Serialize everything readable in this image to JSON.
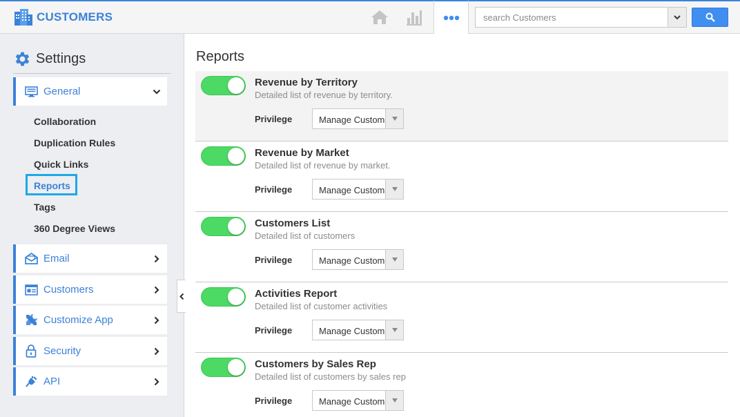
{
  "app": {
    "title": "CUSTOMERS",
    "brand_color": "#3b82d8"
  },
  "topbar": {
    "icons": [
      "home-icon",
      "bar-chart-icon",
      "more-icon"
    ],
    "search_placeholder": "search Customers",
    "search_button_icon": "search-icon"
  },
  "sidebar": {
    "title": "Settings",
    "general": {
      "label": "General",
      "expanded": true
    },
    "sub_items": [
      {
        "label": "Collaboration",
        "active": false
      },
      {
        "label": "Duplication Rules",
        "active": false
      },
      {
        "label": "Quick Links",
        "active": false
      },
      {
        "label": "Reports",
        "active": true
      },
      {
        "label": "Tags",
        "active": false
      },
      {
        "label": "360 Degree Views",
        "active": false
      }
    ],
    "items": [
      {
        "label": "Email",
        "icon": "email-icon"
      },
      {
        "label": "Customers",
        "icon": "customers-icon"
      },
      {
        "label": "Customize App",
        "icon": "tools-icon"
      },
      {
        "label": "Security",
        "icon": "lock-icon"
      },
      {
        "label": "API",
        "icon": "plug-icon"
      }
    ]
  },
  "main": {
    "title": "Reports",
    "privilege_label": "Privilege",
    "reports": [
      {
        "title": "Revenue by Territory",
        "desc": "Detailed list of revenue by territory.",
        "enabled": true,
        "privilege": "Manage Customers"
      },
      {
        "title": "Revenue by Market",
        "desc": "Detailed list of revenue by market.",
        "enabled": true,
        "privilege": "Manage Customers"
      },
      {
        "title": "Customers List",
        "desc": "Detailed list of customers",
        "enabled": true,
        "privilege": "Manage Customers"
      },
      {
        "title": "Activities Report",
        "desc": "Detailed list of customer activities",
        "enabled": true,
        "privilege": "Manage Customers"
      },
      {
        "title": "Customers by Sales Rep",
        "desc": "Detailed list of customers by sales rep",
        "enabled": true,
        "privilege": "Manage Customers"
      }
    ]
  }
}
